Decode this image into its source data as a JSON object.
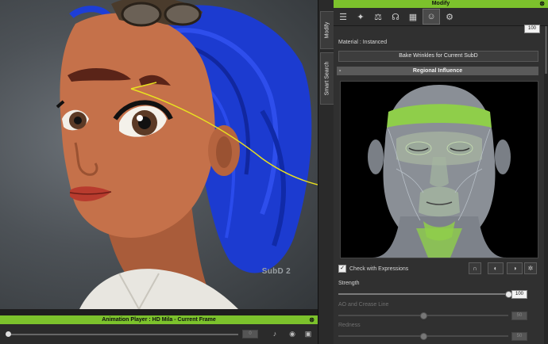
{
  "viewport": {
    "subd_label": "SubD 2"
  },
  "side_tabs": {
    "modify": "Modify",
    "smart_search": "Smart Search"
  },
  "panel": {
    "title": "Modify",
    "toolbar_icons": [
      "sliders-icon",
      "run-pose-icon",
      "balance-icon",
      "morph-icon",
      "checker-icon",
      "head-icon",
      "gear-icon"
    ],
    "top_value": "100",
    "material_label": "Material : Instanced",
    "bake_button": "Bake Wrinkles for Current SubD",
    "section_title": "Regional Influence",
    "section_toggle": "-",
    "check_expressions": "Check with Expressions",
    "strength_label": "Strength",
    "strength_value": "100",
    "strength_fraction": 1.0,
    "ao_label": "AO and Crease Line",
    "ao_value": "50",
    "ao_fraction": 0.5,
    "redness_label": "Redness",
    "redness_value": "50",
    "redness_fraction": 0.5
  },
  "anim": {
    "title": "Animation Player : HD Mila - Current Frame",
    "frame_value": "0"
  },
  "colors": {
    "accent": "#7cc22c",
    "hair": "#1d3ed6",
    "skin": "#c5714a",
    "callout": "#e8e020",
    "zone_green": "#8fce4a"
  }
}
